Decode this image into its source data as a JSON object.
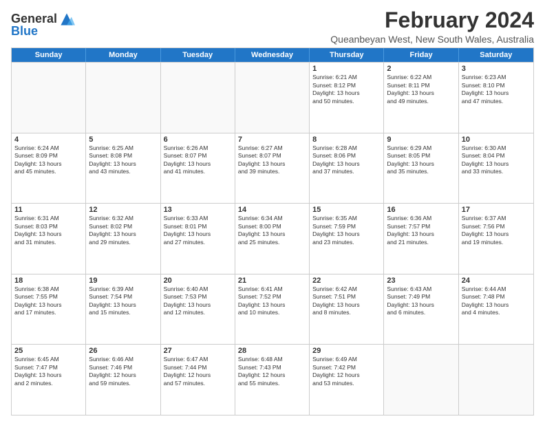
{
  "logo": {
    "general": "General",
    "blue": "Blue"
  },
  "title": "February 2024",
  "subtitle": "Queanbeyan West, New South Wales, Australia",
  "calendar": {
    "headers": [
      "Sunday",
      "Monday",
      "Tuesday",
      "Wednesday",
      "Thursday",
      "Friday",
      "Saturday"
    ],
    "weeks": [
      [
        {
          "day": "",
          "lines": []
        },
        {
          "day": "",
          "lines": []
        },
        {
          "day": "",
          "lines": []
        },
        {
          "day": "",
          "lines": []
        },
        {
          "day": "1",
          "lines": [
            "Sunrise: 6:21 AM",
            "Sunset: 8:12 PM",
            "Daylight: 13 hours",
            "and 50 minutes."
          ]
        },
        {
          "day": "2",
          "lines": [
            "Sunrise: 6:22 AM",
            "Sunset: 8:11 PM",
            "Daylight: 13 hours",
            "and 49 minutes."
          ]
        },
        {
          "day": "3",
          "lines": [
            "Sunrise: 6:23 AM",
            "Sunset: 8:10 PM",
            "Daylight: 13 hours",
            "and 47 minutes."
          ]
        }
      ],
      [
        {
          "day": "4",
          "lines": [
            "Sunrise: 6:24 AM",
            "Sunset: 8:09 PM",
            "Daylight: 13 hours",
            "and 45 minutes."
          ]
        },
        {
          "day": "5",
          "lines": [
            "Sunrise: 6:25 AM",
            "Sunset: 8:08 PM",
            "Daylight: 13 hours",
            "and 43 minutes."
          ]
        },
        {
          "day": "6",
          "lines": [
            "Sunrise: 6:26 AM",
            "Sunset: 8:07 PM",
            "Daylight: 13 hours",
            "and 41 minutes."
          ]
        },
        {
          "day": "7",
          "lines": [
            "Sunrise: 6:27 AM",
            "Sunset: 8:07 PM",
            "Daylight: 13 hours",
            "and 39 minutes."
          ]
        },
        {
          "day": "8",
          "lines": [
            "Sunrise: 6:28 AM",
            "Sunset: 8:06 PM",
            "Daylight: 13 hours",
            "and 37 minutes."
          ]
        },
        {
          "day": "9",
          "lines": [
            "Sunrise: 6:29 AM",
            "Sunset: 8:05 PM",
            "Daylight: 13 hours",
            "and 35 minutes."
          ]
        },
        {
          "day": "10",
          "lines": [
            "Sunrise: 6:30 AM",
            "Sunset: 8:04 PM",
            "Daylight: 13 hours",
            "and 33 minutes."
          ]
        }
      ],
      [
        {
          "day": "11",
          "lines": [
            "Sunrise: 6:31 AM",
            "Sunset: 8:03 PM",
            "Daylight: 13 hours",
            "and 31 minutes."
          ]
        },
        {
          "day": "12",
          "lines": [
            "Sunrise: 6:32 AM",
            "Sunset: 8:02 PM",
            "Daylight: 13 hours",
            "and 29 minutes."
          ]
        },
        {
          "day": "13",
          "lines": [
            "Sunrise: 6:33 AM",
            "Sunset: 8:01 PM",
            "Daylight: 13 hours",
            "and 27 minutes."
          ]
        },
        {
          "day": "14",
          "lines": [
            "Sunrise: 6:34 AM",
            "Sunset: 8:00 PM",
            "Daylight: 13 hours",
            "and 25 minutes."
          ]
        },
        {
          "day": "15",
          "lines": [
            "Sunrise: 6:35 AM",
            "Sunset: 7:59 PM",
            "Daylight: 13 hours",
            "and 23 minutes."
          ]
        },
        {
          "day": "16",
          "lines": [
            "Sunrise: 6:36 AM",
            "Sunset: 7:57 PM",
            "Daylight: 13 hours",
            "and 21 minutes."
          ]
        },
        {
          "day": "17",
          "lines": [
            "Sunrise: 6:37 AM",
            "Sunset: 7:56 PM",
            "Daylight: 13 hours",
            "and 19 minutes."
          ]
        }
      ],
      [
        {
          "day": "18",
          "lines": [
            "Sunrise: 6:38 AM",
            "Sunset: 7:55 PM",
            "Daylight: 13 hours",
            "and 17 minutes."
          ]
        },
        {
          "day": "19",
          "lines": [
            "Sunrise: 6:39 AM",
            "Sunset: 7:54 PM",
            "Daylight: 13 hours",
            "and 15 minutes."
          ]
        },
        {
          "day": "20",
          "lines": [
            "Sunrise: 6:40 AM",
            "Sunset: 7:53 PM",
            "Daylight: 13 hours",
            "and 12 minutes."
          ]
        },
        {
          "day": "21",
          "lines": [
            "Sunrise: 6:41 AM",
            "Sunset: 7:52 PM",
            "Daylight: 13 hours",
            "and 10 minutes."
          ]
        },
        {
          "day": "22",
          "lines": [
            "Sunrise: 6:42 AM",
            "Sunset: 7:51 PM",
            "Daylight: 13 hours",
            "and 8 minutes."
          ]
        },
        {
          "day": "23",
          "lines": [
            "Sunrise: 6:43 AM",
            "Sunset: 7:49 PM",
            "Daylight: 13 hours",
            "and 6 minutes."
          ]
        },
        {
          "day": "24",
          "lines": [
            "Sunrise: 6:44 AM",
            "Sunset: 7:48 PM",
            "Daylight: 13 hours",
            "and 4 minutes."
          ]
        }
      ],
      [
        {
          "day": "25",
          "lines": [
            "Sunrise: 6:45 AM",
            "Sunset: 7:47 PM",
            "Daylight: 13 hours",
            "and 2 minutes."
          ]
        },
        {
          "day": "26",
          "lines": [
            "Sunrise: 6:46 AM",
            "Sunset: 7:46 PM",
            "Daylight: 12 hours",
            "and 59 minutes."
          ]
        },
        {
          "day": "27",
          "lines": [
            "Sunrise: 6:47 AM",
            "Sunset: 7:44 PM",
            "Daylight: 12 hours",
            "and 57 minutes."
          ]
        },
        {
          "day": "28",
          "lines": [
            "Sunrise: 6:48 AM",
            "Sunset: 7:43 PM",
            "Daylight: 12 hours",
            "and 55 minutes."
          ]
        },
        {
          "day": "29",
          "lines": [
            "Sunrise: 6:49 AM",
            "Sunset: 7:42 PM",
            "Daylight: 12 hours",
            "and 53 minutes."
          ]
        },
        {
          "day": "",
          "lines": []
        },
        {
          "day": "",
          "lines": []
        }
      ]
    ]
  }
}
